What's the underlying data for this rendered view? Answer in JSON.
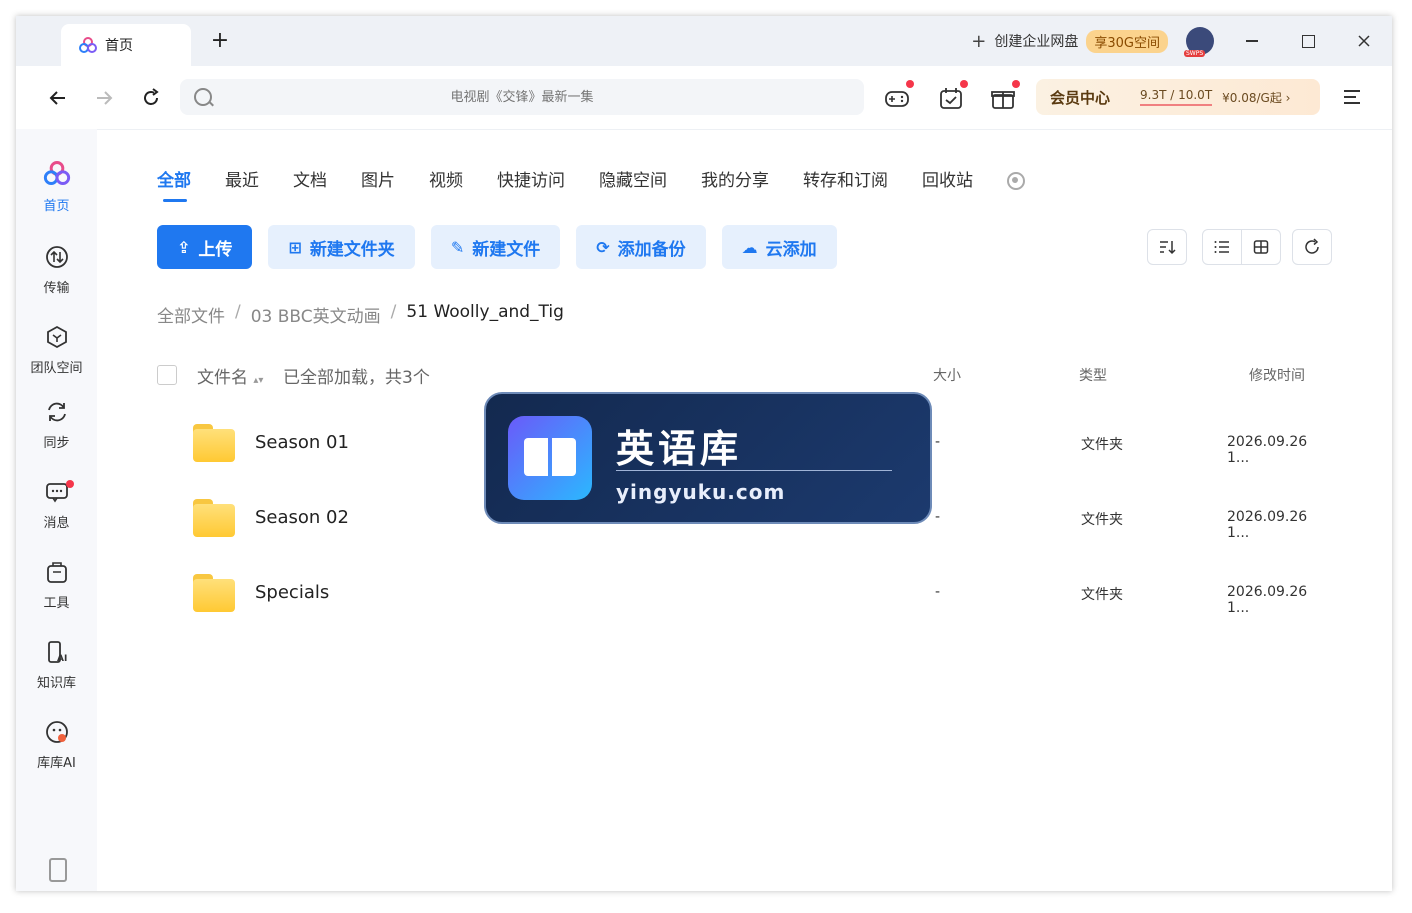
{
  "tabbar": {
    "tab_title": "首页",
    "new_tab": "+",
    "create_enterprise": "创建企业网盘",
    "enterprise_badge": "享30G空间"
  },
  "address": {
    "search_placeholder": "电视剧《交锋》最新一集",
    "vip_label": "会员中心",
    "storage": "9.3T / 10.0T",
    "price": "¥0.08/G起 ›"
  },
  "sidebar": {
    "items": [
      {
        "label": "首页"
      },
      {
        "label": "传输"
      },
      {
        "label": "团队空间"
      },
      {
        "label": "同步"
      },
      {
        "label": "消息"
      },
      {
        "label": "工具"
      },
      {
        "label": "知识库"
      },
      {
        "label": "库库AI"
      }
    ]
  },
  "content_tabs": [
    "全部",
    "最近",
    "文档",
    "图片",
    "视频",
    "快捷访问",
    "隐藏空间",
    "我的分享",
    "转存和订阅",
    "回收站"
  ],
  "actions": {
    "upload": "上传",
    "new_folder": "新建文件夹",
    "new_file": "新建文件",
    "add_backup": "添加备份",
    "cloud_add": "云添加"
  },
  "breadcrumb": {
    "root": "全部文件",
    "level1": "03 BBC英文动画",
    "current": "51 Woolly_and_Tig",
    "sep": "/"
  },
  "table": {
    "col_name": "文件名",
    "loaded_info": "已全部加载，共3个",
    "col_size": "大小",
    "col_type": "类型",
    "col_time": "修改时间",
    "rows": [
      {
        "name": "Season 01",
        "size": "-",
        "type": "文件夹",
        "time": "2026.09.26 1..."
      },
      {
        "name": "Season 02",
        "size": "-",
        "type": "文件夹",
        "time": "2026.09.26 1..."
      },
      {
        "name": "Specials",
        "size": "-",
        "type": "文件夹",
        "time": "2026.09.26 1..."
      }
    ]
  },
  "watermark": {
    "title": "英语库",
    "url": "yingyuku.com"
  },
  "colors": {
    "accent": "#1f78f0",
    "folder": "#ffd152",
    "notification_dot": "#f5364a"
  }
}
